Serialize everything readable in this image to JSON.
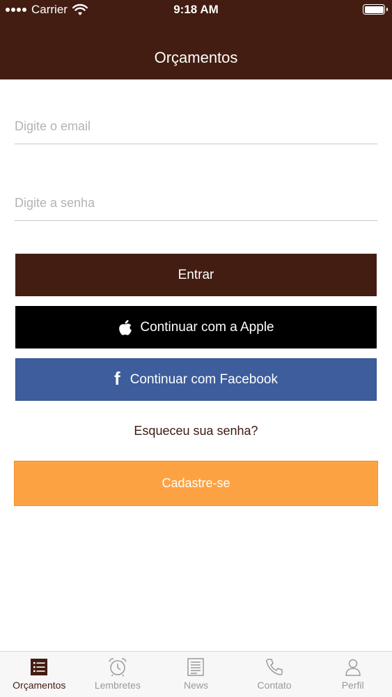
{
  "status_bar": {
    "carrier": "Carrier",
    "time": "9:18 AM"
  },
  "nav": {
    "title": "Orçamentos"
  },
  "form": {
    "email_placeholder": "Digite o email",
    "password_placeholder": "Digite a senha"
  },
  "buttons": {
    "login": "Entrar",
    "apple": "Continuar com a Apple",
    "facebook": "Continuar com Facebook",
    "forgot_password": "Esqueceu sua senha?",
    "signup": "Cadastre-se"
  },
  "tabs": [
    {
      "label": "Orçamentos",
      "icon": "list-icon",
      "active": true
    },
    {
      "label": "Lembretes",
      "icon": "alarm-clock-icon",
      "active": false
    },
    {
      "label": "News",
      "icon": "newspaper-icon",
      "active": false
    },
    {
      "label": "Contato",
      "icon": "phone-icon",
      "active": false
    },
    {
      "label": "Perfil",
      "icon": "person-icon",
      "active": false
    }
  ],
  "colors": {
    "brand": "#431d11",
    "apple": "#000000",
    "facebook": "#3d5d9c",
    "signup": "#fda243",
    "tab_inactive": "#9a9a9a"
  }
}
